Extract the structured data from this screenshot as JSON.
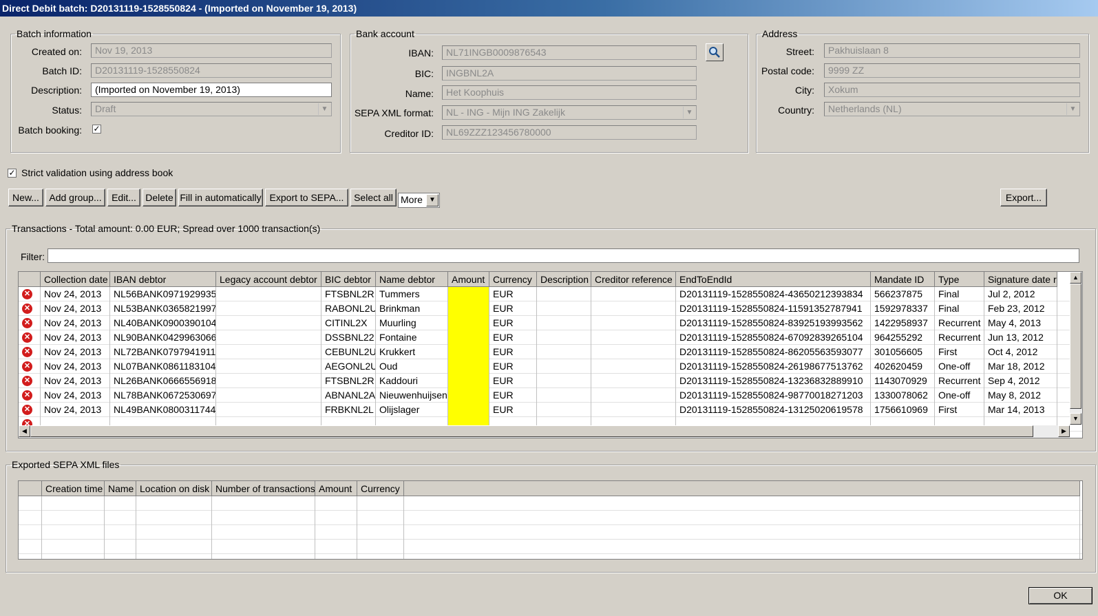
{
  "window": {
    "title": "Direct Debit batch: D20131119-1528550824 - (Imported on November 19, 2013)"
  },
  "batch": {
    "legend": "Batch information",
    "created_label": "Created on:",
    "created": "Nov 19, 2013",
    "id_label": "Batch ID:",
    "id": "D20131119-1528550824",
    "desc_label": "Description:",
    "desc": "(Imported on November 19, 2013)",
    "status_label": "Status:",
    "status": "Draft",
    "booking_label": "Batch booking:",
    "booking_checked": true
  },
  "bank": {
    "legend": "Bank account",
    "iban_label": "IBAN:",
    "iban": "NL71INGB0009876543",
    "bic_label": "BIC:",
    "bic": "INGBNL2A",
    "name_label": "Name:",
    "name": "Het Koophuis",
    "format_label": "SEPA XML format:",
    "format": "NL - ING - Mijn ING Zakelijk",
    "creditor_label": "Creditor ID:",
    "creditor": "NL69ZZZ123456780000"
  },
  "address": {
    "legend": "Address",
    "street_label": "Street:",
    "street": "Pakhuislaan 8",
    "postal_label": "Postal code:",
    "postal": "9999 ZZ",
    "city_label": "City:",
    "city": "Xokum",
    "country_label": "Country:",
    "country": "Netherlands (NL)"
  },
  "strict": {
    "label": "Strict validation using address book",
    "checked": true
  },
  "toolbar": {
    "new": "New...",
    "add_group": "Add group...",
    "edit": "Edit...",
    "delete": "Delete",
    "fill": "Fill in automatically",
    "export_sepa": "Export to SEPA...",
    "select_all": "Select all",
    "more": "More",
    "export": "Export..."
  },
  "transactions": {
    "legend": "Transactions - Total amount: 0.00 EUR; Spread over 1000 transaction(s)",
    "filter_label": "Filter:",
    "filter_value": "",
    "columns": [
      "",
      "Collection date",
      "IBAN debtor",
      "Legacy account debtor",
      "BIC debtor",
      "Name debtor",
      "Amount",
      "Currency",
      "Description",
      "Creditor reference",
      "EndToEndId",
      "Mandate ID",
      "Type",
      "Signature date r"
    ],
    "rows": [
      [
        "Nov 24, 2013",
        "NL56BANK0971929935",
        "",
        "FTSBNL2R",
        "Tummers",
        "",
        "EUR",
        "",
        "",
        "D20131119-1528550824-43650212393834",
        "566237875",
        "Final",
        "Jul 2, 2012"
      ],
      [
        "Nov 24, 2013",
        "NL53BANK0365821997",
        "",
        "RABONL2U",
        "Brinkman",
        "",
        "EUR",
        "",
        "",
        "D20131119-1528550824-11591352787941",
        "1592978337",
        "Final",
        "Feb 23, 2012"
      ],
      [
        "Nov 24, 2013",
        "NL40BANK0900390104",
        "",
        "CITINL2X",
        "Muurling",
        "",
        "EUR",
        "",
        "",
        "D20131119-1528550824-83925193993562",
        "1422958937",
        "Recurrent",
        "May 4, 2013"
      ],
      [
        "Nov 24, 2013",
        "NL90BANK0429963066",
        "",
        "DSSBNL22",
        "Fontaine",
        "",
        "EUR",
        "",
        "",
        "D20131119-1528550824-67092839265104",
        "964255292",
        "Recurrent",
        "Jun 13, 2012"
      ],
      [
        "Nov 24, 2013",
        "NL72BANK0797941911",
        "",
        "CEBUNL2U",
        "Krukkert",
        "",
        "EUR",
        "",
        "",
        "D20131119-1528550824-86205563593077",
        "301056605",
        "First",
        "Oct 4, 2012"
      ],
      [
        "Nov 24, 2013",
        "NL07BANK0861183104",
        "",
        "AEGONL2U",
        "Oud",
        "",
        "EUR",
        "",
        "",
        "D20131119-1528550824-26198677513762",
        "402620459",
        "One-off",
        "Mar 18, 2012"
      ],
      [
        "Nov 24, 2013",
        "NL26BANK0666556918",
        "",
        "FTSBNL2R",
        "Kaddouri",
        "",
        "EUR",
        "",
        "",
        "D20131119-1528550824-13236832889910",
        "1143070929",
        "Recurrent",
        "Sep 4, 2012"
      ],
      [
        "Nov 24, 2013",
        "NL78BANK0672530697",
        "",
        "ABNANL2A",
        "Nieuwenhuijsen",
        "",
        "EUR",
        "",
        "",
        "D20131119-1528550824-98770018271203",
        "1330078062",
        "One-off",
        "May 8, 2012"
      ],
      [
        "Nov 24, 2013",
        "NL49BANK0800311744",
        "",
        "FRBKNL2L",
        "Olijslager",
        "",
        "EUR",
        "",
        "",
        "D20131119-1528550824-13125020619578",
        "1756610969",
        "First",
        "Mar 14, 2013"
      ]
    ]
  },
  "exported": {
    "legend": "Exported SEPA XML files",
    "columns": [
      "",
      "Creation time",
      "Name",
      "Location on disk",
      "Number of transactions",
      "Amount",
      "Currency"
    ]
  },
  "ok": "OK",
  "colors": {
    "amount_highlight": "#ffff00",
    "error": "#d21c1c",
    "title_start": "#0a246a"
  }
}
